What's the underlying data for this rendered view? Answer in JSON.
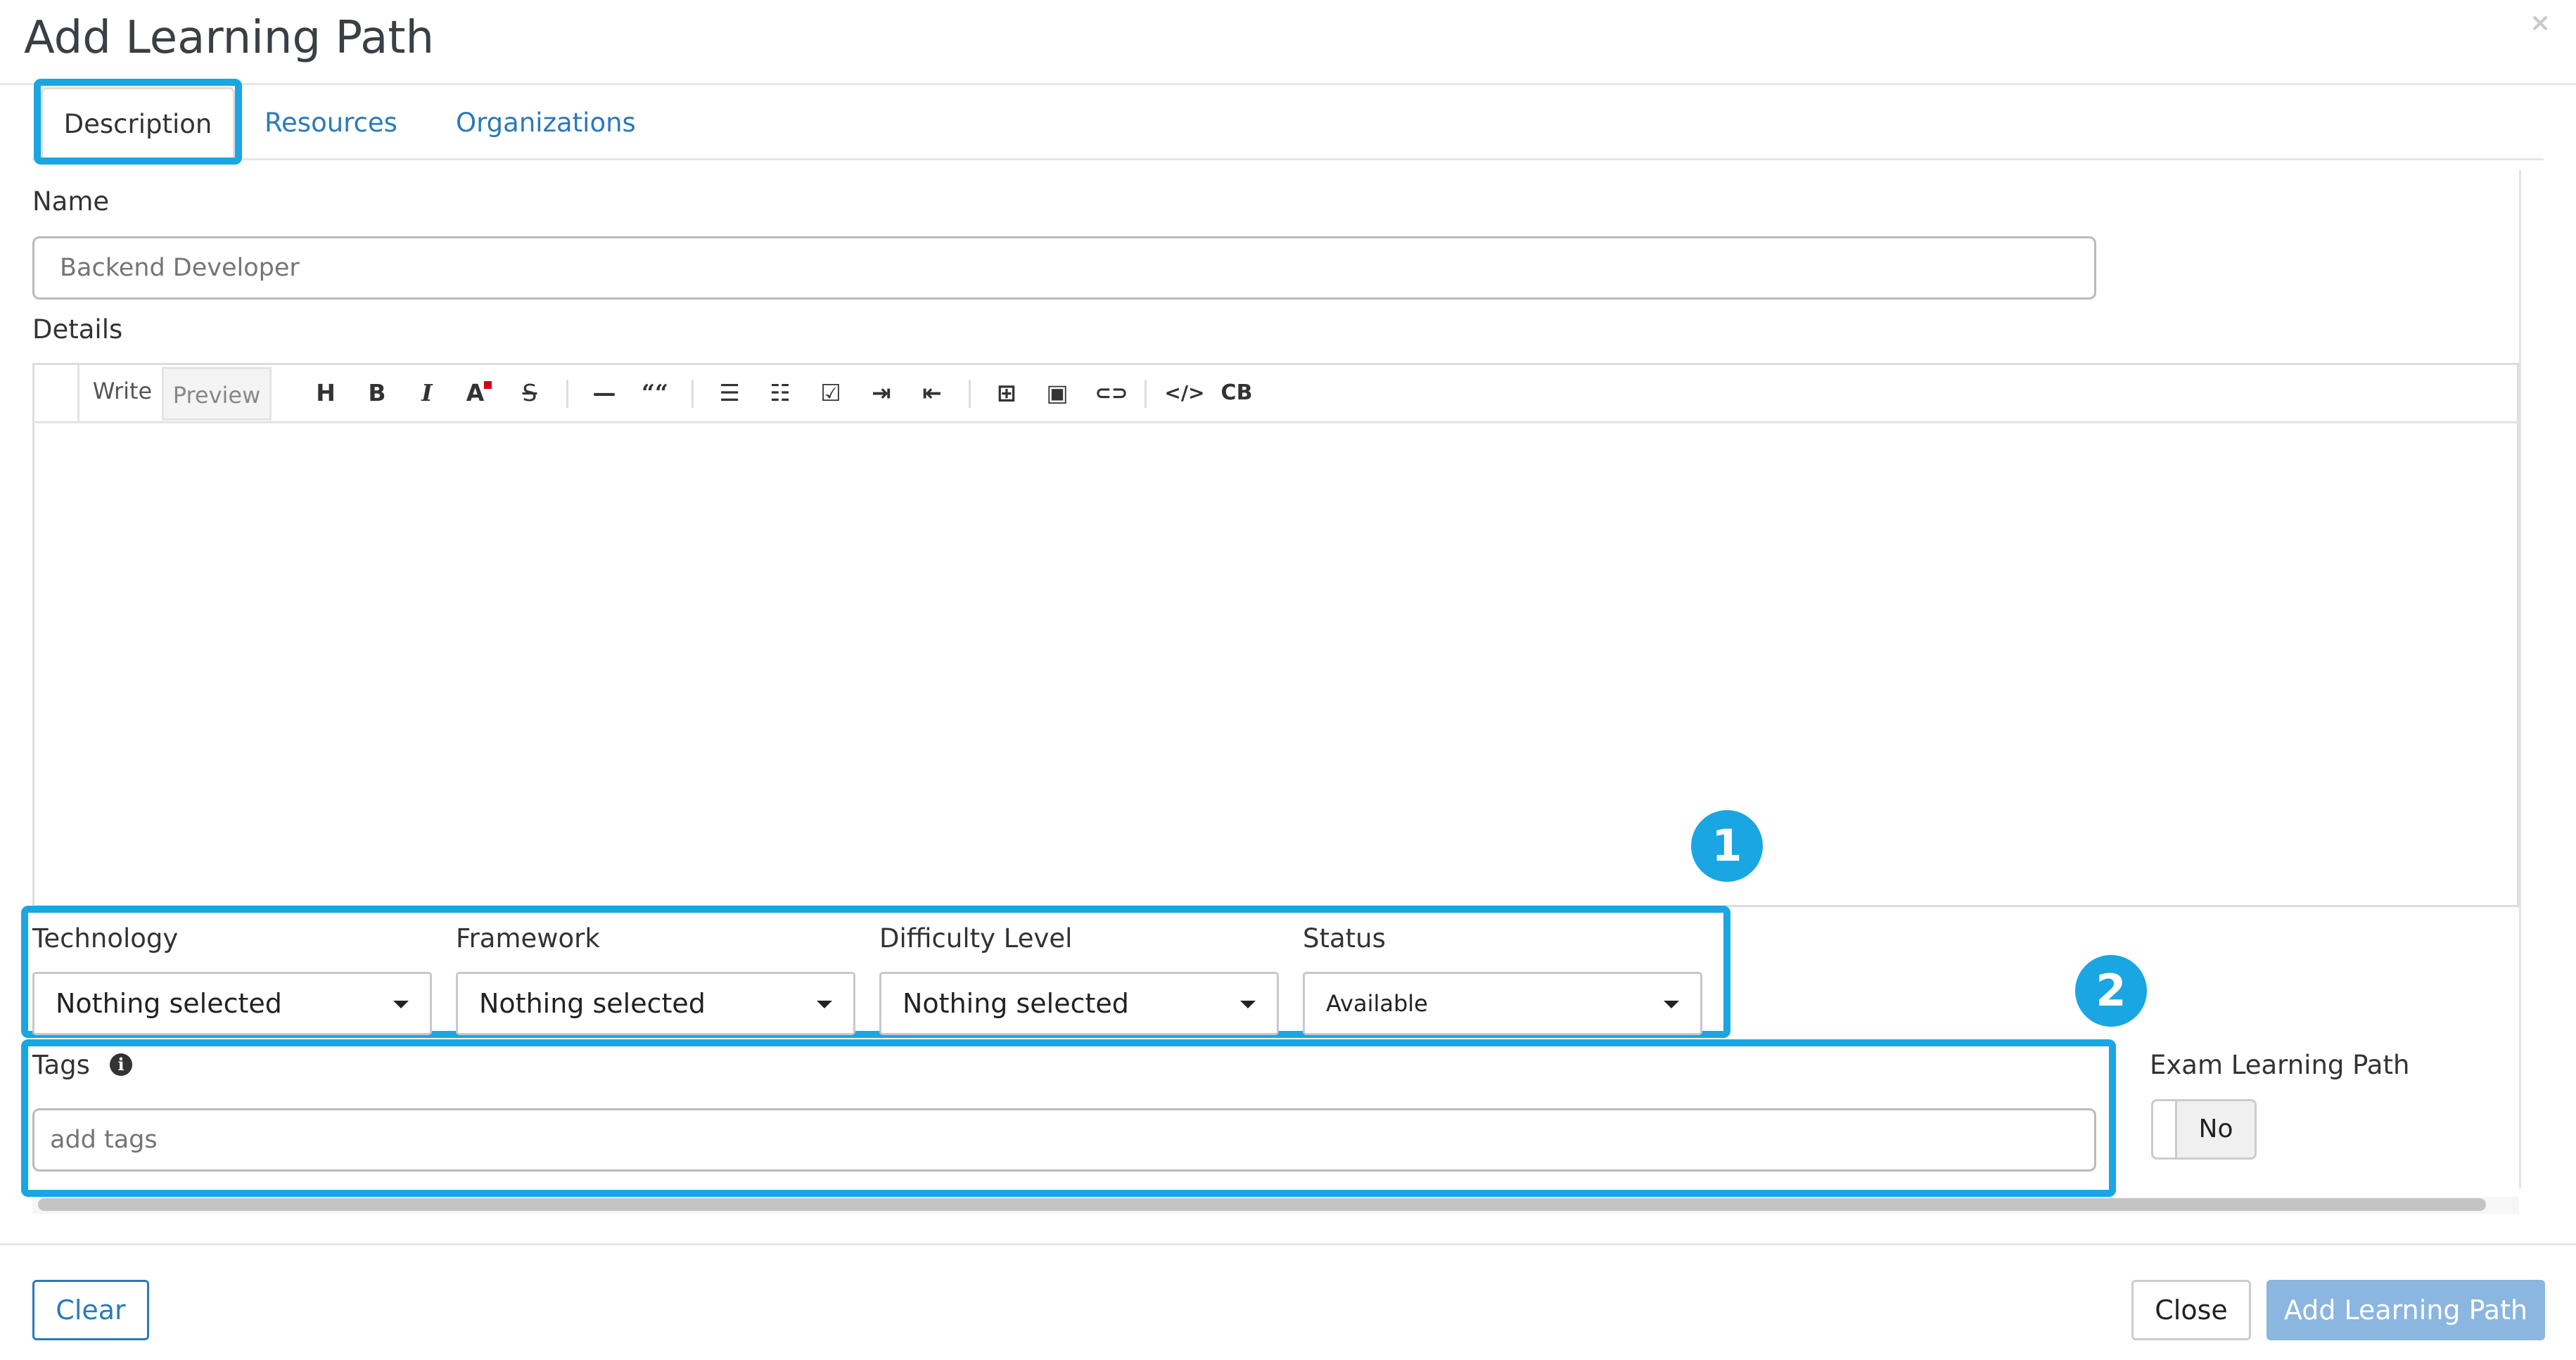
{
  "dialog": {
    "title": "Add Learning Path",
    "close_icon": "×"
  },
  "tabs": [
    {
      "label": "Description",
      "active": true
    },
    {
      "label": "Resources",
      "active": false
    },
    {
      "label": "Organizations",
      "active": false
    }
  ],
  "name_field": {
    "label": "Name",
    "placeholder": "Backend Developer",
    "value": ""
  },
  "details": {
    "label": "Details",
    "editor_tabs": [
      {
        "label": "Write",
        "active": true
      },
      {
        "label": "Preview",
        "active": false
      }
    ],
    "toolbar_icons": [
      "heading-icon",
      "bold-icon",
      "italic-icon",
      "text-color-icon",
      "strikethrough-icon",
      "horizontal-rule-icon",
      "quote-icon",
      "bullet-list-icon",
      "numbered-list-icon",
      "task-list-icon",
      "indent-icon",
      "outdent-icon",
      "table-icon",
      "image-icon",
      "link-icon",
      "code-icon",
      "code-block-icon"
    ],
    "toolbar_glyphs": {
      "heading": "H",
      "bold": "B",
      "italic": "I",
      "text_color": "A",
      "strike": "S",
      "hr": "—",
      "quote": "““",
      "ul": "☰",
      "ol": "☷",
      "task": "☑",
      "indent": "⇥",
      "outdent": "⇤",
      "table": "⊞",
      "image": "▣",
      "link": "⊂⊃",
      "code": "</>",
      "codeblock": "CB"
    }
  },
  "filters": [
    {
      "label": "Technology",
      "value": "Nothing selected"
    },
    {
      "label": "Framework",
      "value": "Nothing selected"
    },
    {
      "label": "Difficulty Level",
      "value": "Nothing selected"
    },
    {
      "label": "Status",
      "value": "Available"
    }
  ],
  "tags": {
    "label": "Tags",
    "placeholder": "add tags",
    "info_icon": "i"
  },
  "exam": {
    "label": "Exam Learning Path",
    "toggle_value": "No"
  },
  "callouts": [
    {
      "number": "1"
    },
    {
      "number": "2"
    }
  ],
  "footer": {
    "clear_label": "Clear",
    "close_label": "Close",
    "submit_label": "Add Learning Path"
  },
  "colors": {
    "accent": "#1aa6e2",
    "link": "#2a7ab8",
    "submit_bg": "#8ab6df"
  }
}
